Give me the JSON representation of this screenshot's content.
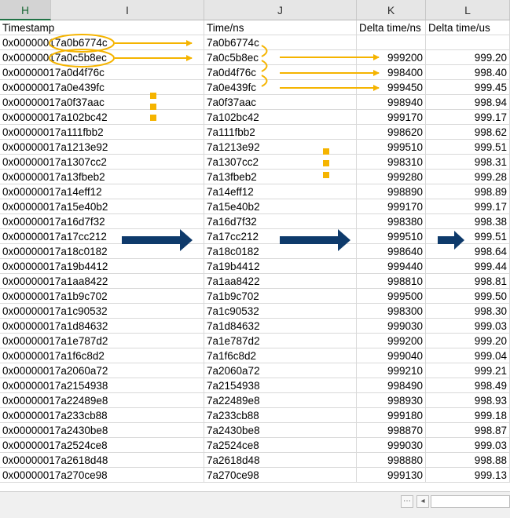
{
  "columns": [
    {
      "letter": "H",
      "selected": true
    },
    {
      "letter": "I",
      "selected": false
    },
    {
      "letter": "J",
      "selected": false
    },
    {
      "letter": "K",
      "selected": false
    },
    {
      "letter": "L",
      "selected": false
    }
  ],
  "headers": {
    "timestamp": "Timestamp",
    "time_ns": "Time/ns",
    "delta_ns": "Delta time/ns",
    "delta_us": "Delta time/us"
  },
  "rows": [
    {
      "ts": "0x00000017a0b6774c",
      "ns": "7a0b6774c",
      "dns": "",
      "dus": ""
    },
    {
      "ts": "0x00000017a0c5b8ec",
      "ns": "7a0c5b8ec",
      "dns": "999200",
      "dus": "999.20"
    },
    {
      "ts": "0x00000017a0d4f76c",
      "ns": "7a0d4f76c",
      "dns": "998400",
      "dus": "998.40"
    },
    {
      "ts": "0x00000017a0e439fc",
      "ns": "7a0e439fc",
      "dns": "999450",
      "dus": "999.45"
    },
    {
      "ts": "0x00000017a0f37aac",
      "ns": "7a0f37aac",
      "dns": "998940",
      "dus": "998.94"
    },
    {
      "ts": "0x00000017a102bc42",
      "ns": "7a102bc42",
      "dns": "999170",
      "dus": "999.17"
    },
    {
      "ts": "0x00000017a111fbb2",
      "ns": "7a111fbb2",
      "dns": "998620",
      "dns2": "",
      "dus": "998.62"
    },
    {
      "ts": "0x00000017a1213e92",
      "ns": "7a1213e92",
      "dns": "999510",
      "dus": "999.51"
    },
    {
      "ts": "0x00000017a1307cc2",
      "ns": "7a1307cc2",
      "dns": "998310",
      "dus": "998.31"
    },
    {
      "ts": "0x00000017a13fbeb2",
      "ns": "7a13fbeb2",
      "dns": "999280",
      "dus": "999.28"
    },
    {
      "ts": "0x00000017a14eff12",
      "ns": "7a14eff12",
      "dns": "998890",
      "dus": "998.89"
    },
    {
      "ts": "0x00000017a15e40b2",
      "ns": "7a15e40b2",
      "dns": "999170",
      "dus": "999.17"
    },
    {
      "ts": "0x00000017a16d7f32",
      "ns": "7a16d7f32",
      "dns": "998380",
      "dus": "998.38"
    },
    {
      "ts": "0x00000017a17cc212",
      "ns": "7a17cc212",
      "dns": "999510",
      "dus": "999.51"
    },
    {
      "ts": "0x00000017a18c0182",
      "ns": "7a18c0182",
      "dns": "998640",
      "dus": "998.64"
    },
    {
      "ts": "0x00000017a19b4412",
      "ns": "7a19b4412",
      "dns": "999440",
      "dus": "999.44"
    },
    {
      "ts": "0x00000017a1aa8422",
      "ns": "7a1aa8422",
      "dns": "998810",
      "dus": "998.81"
    },
    {
      "ts": "0x00000017a1b9c702",
      "ns": "7a1b9c702",
      "dns": "999500",
      "dus": "999.50"
    },
    {
      "ts": "0x00000017a1c90532",
      "ns": "7a1c90532",
      "dns": "998300",
      "dus": "998.30"
    },
    {
      "ts": "0x00000017a1d84632",
      "ns": "7a1d84632",
      "dns": "999030",
      "dus": "999.03"
    },
    {
      "ts": "0x00000017a1e787d2",
      "ns": "7a1e787d2",
      "dns": "999200",
      "dus": "999.20"
    },
    {
      "ts": "0x00000017a1f6c8d2",
      "ns": "7a1f6c8d2",
      "dns": "999040",
      "dus": "999.04"
    },
    {
      "ts": "0x00000017a2060a72",
      "ns": "7a2060a72",
      "dns": "999210",
      "dus": "999.21"
    },
    {
      "ts": "0x00000017a2154938",
      "ns": "7a2154938",
      "dns": "998490",
      "dus": "998.49"
    },
    {
      "ts": "0x00000017a22489e8",
      "ns": "7a22489e8",
      "dns": "998930",
      "dus": "998.93"
    },
    {
      "ts": "0x00000017a233cb88",
      "ns": "7a233cb88",
      "dns": "999180",
      "dus": "999.18"
    },
    {
      "ts": "0x00000017a2430be8",
      "ns": "7a2430be8",
      "dns": "998870",
      "dus": "998.87"
    },
    {
      "ts": "0x00000017a2524ce8",
      "ns": "7a2524ce8",
      "dns": "999030",
      "dus": "999.03"
    },
    {
      "ts": "0x00000017a2618d48",
      "ns": "7a2618d48",
      "dns": "998880",
      "dus": "998.88"
    },
    {
      "ts": "0x00000017a270ce98",
      "ns": "7a270ce98",
      "dns": "999130",
      "dus": "999.13"
    }
  ],
  "colors": {
    "annotation_orange": "#f5b400",
    "annotation_navy": "#0e3a6b",
    "header_bg": "#e6e6e6",
    "grid_line": "#d9d9d9"
  },
  "statusbar": {
    "nav_prev_icon": "ellipsis-icon",
    "scroll_left_icon": "triangle-left-icon"
  }
}
